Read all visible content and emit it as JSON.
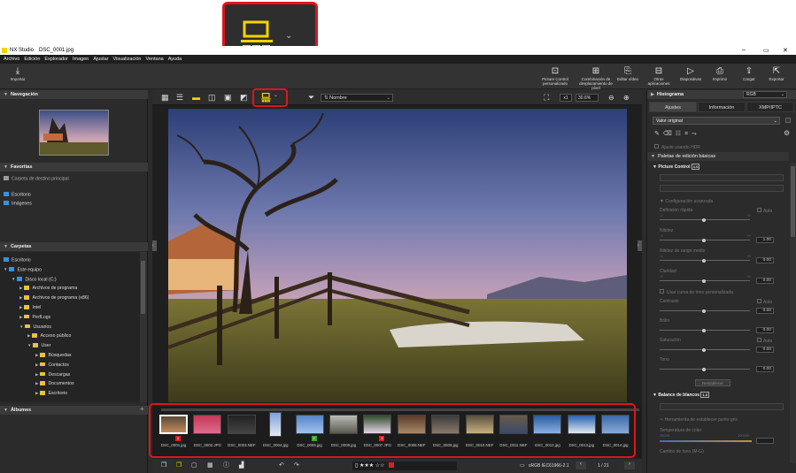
{
  "window": {
    "app_name": "NX Studio",
    "file_name": "DSC_0001.jpg"
  },
  "menu": [
    "Archivo",
    "Edición",
    "Explorador",
    "Imagen",
    "Ajustar",
    "Visualización",
    "Ventana",
    "Ayuda"
  ],
  "toolbar": {
    "import_label": "Importar",
    "right_buttons": [
      {
        "label": "Picture Control personalizado",
        "icon": "picture-control-icon"
      },
      {
        "label": "Combinación de desplazamiento de píxel",
        "icon": "pixel-shift-icon"
      },
      {
        "label": "Editar vídeo",
        "icon": "edit-video-icon"
      },
      {
        "label": "Otras aplicaciones",
        "icon": "other-apps-icon"
      },
      {
        "label": "Diapositivas",
        "icon": "slideshow-icon"
      },
      {
        "label": "Imprimir",
        "icon": "print-icon"
      },
      {
        "label": "Cargar",
        "icon": "upload-icon"
      },
      {
        "label": "Exportar",
        "icon": "export-icon"
      }
    ]
  },
  "left": {
    "navigation_title": "Navegación",
    "favorites_title": "Favoritas",
    "favorites_add": "Carpeta de destino principal",
    "favorites": [
      "Escritorio",
      "Imágenes"
    ],
    "folders_title": "Carpetas",
    "tree": [
      {
        "label": "Escritorio",
        "level": 0
      },
      {
        "label": "Este equipo",
        "level": 0
      },
      {
        "label": "Disco local (C:)",
        "level": 1
      },
      {
        "label": "Archivos de programa",
        "level": 2
      },
      {
        "label": "Archivos de programa (x86)",
        "level": 2
      },
      {
        "label": "Intel",
        "level": 2
      },
      {
        "label": "PerfLogs",
        "level": 2
      },
      {
        "label": "Usuarios",
        "level": 2
      },
      {
        "label": "Acceso público",
        "level": 3
      },
      {
        "label": "User",
        "level": 3
      },
      {
        "label": "Búsquedas",
        "level": 4
      },
      {
        "label": "Contactos",
        "level": 4
      },
      {
        "label": "Descargas",
        "level": 4
      },
      {
        "label": "Documentos",
        "level": 4
      },
      {
        "label": "Escritorio",
        "level": 4
      }
    ],
    "albums_title": "Álbumes"
  },
  "viewer": {
    "sort_label": "Nombre",
    "zoom_mult": "x1",
    "zoom_percent": "30.6%",
    "thumbnails": [
      {
        "name": "DSC_0001.jpg",
        "badge": "1"
      },
      {
        "name": "DSC_0002.JPG",
        "badge": ""
      },
      {
        "name": "DSC_0003.NEF",
        "badge": ""
      },
      {
        "name": "DSC_0004.jpg",
        "badge": ""
      },
      {
        "name": "DSC_0005.jpg",
        "badge": "2"
      },
      {
        "name": "DSC_0006.jpg",
        "badge": ""
      },
      {
        "name": "DSC_0007.JPG",
        "badge": "3"
      },
      {
        "name": "DSC_0008.NEF",
        "badge": ""
      },
      {
        "name": "DSC_0009.jpg",
        "badge": ""
      },
      {
        "name": "DSC_0010.NEF",
        "badge": ""
      },
      {
        "name": "DSC_0011.NEF",
        "badge": ""
      },
      {
        "name": "DSC_0012.jpg",
        "badge": ""
      },
      {
        "name": "DSC_0013.jpg",
        "badge": ""
      },
      {
        "name": "DSC_0014.jpg",
        "badge": ""
      }
    ],
    "color_profile": "sRGB IEC61966-2.1",
    "page_counter": "1 / 21"
  },
  "right": {
    "histogram_title": "Histograma",
    "histogram_mode": "RGB",
    "tabs": [
      "Ajustes",
      "Información",
      "XMP/IPTC"
    ],
    "preset": "Valor original",
    "hdr_label": "Ajuste usando HDR",
    "basic_palette": "Paletas de edición básicas",
    "picture_control": "Picture Control",
    "advanced": "Configuración avanzada",
    "sliders": [
      {
        "label": "Definición rápida",
        "value": "",
        "range": [
          "-2",
          "+2"
        ],
        "auto": true
      },
      {
        "label": "Nitidez",
        "value": "1.00",
        "range": [
          "-3",
          "+9"
        ],
        "auto": false
      },
      {
        "label": "Nitidez de rango medio",
        "value": "0.00",
        "range": [
          "-5",
          "+5"
        ],
        "auto": false
      },
      {
        "label": "Claridad",
        "value": "0.00",
        "range": [
          "-5",
          "+5"
        ],
        "auto": false
      }
    ],
    "curve_label": "Usar curva de tono personalizada",
    "sliders2": [
      {
        "label": "Contraste",
        "value": "0.00",
        "auto": true
      },
      {
        "label": "Brillo",
        "value": "0.00",
        "auto": false
      },
      {
        "label": "Saturación",
        "value": "0.00",
        "auto": true
      },
      {
        "label": "Tono",
        "value": "0.00",
        "auto": false
      }
    ],
    "reset_label": "Restablecer",
    "wb_title": "Balance de blancos",
    "wb_tool": "Herramienta de establecer punto gris",
    "wb_temp": "Temperatura de color",
    "wb_range": [
      "2500K",
      "10000K"
    ],
    "wb_tint": "Cambio de tono (M-G)"
  },
  "callout_zoom_alt": "layout-menu-icon",
  "colors": {
    "accent": "#f5d400",
    "highlight": "#e0141b"
  }
}
